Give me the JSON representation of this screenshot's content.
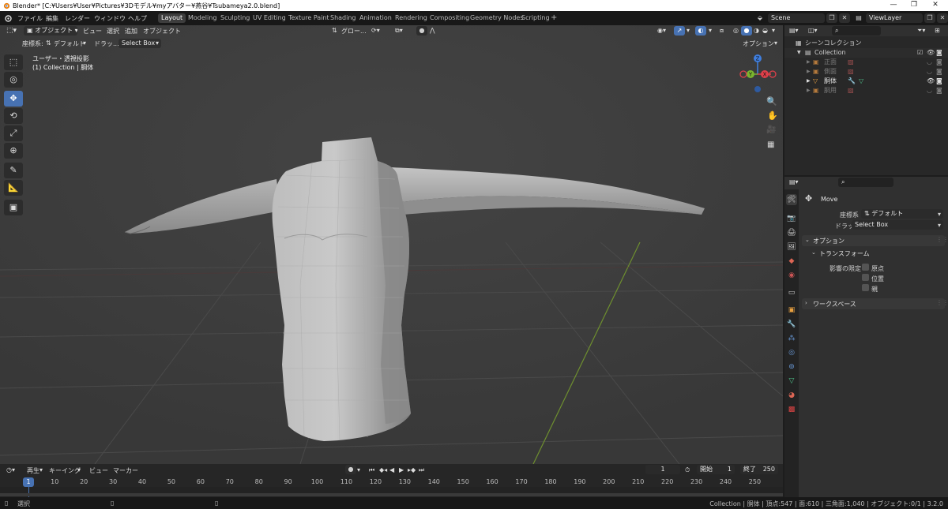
{
  "window": {
    "title": "Blender* [C:¥Users¥User¥Pictures¥3Dモデル¥myアバター¥燕谷¥Tsubameya2.0.blend]"
  },
  "menu": {
    "items": [
      "ファイル",
      "編集",
      "レンダー",
      "ウィンドウ",
      "ヘルプ"
    ],
    "workspaces": [
      "Layout",
      "Modeling",
      "Sculpting",
      "UV Editing",
      "Texture Paint",
      "Shading",
      "Animation",
      "Rendering",
      "Compositing",
      "Geometry Nodes",
      "Scripting"
    ],
    "active_workspace": "Layout",
    "add_tab": "+",
    "scene_label": "Scene",
    "viewlayer_label": "ViewLayer"
  },
  "viewport_header": {
    "mode": "オブジェクト",
    "menus": [
      "ビュー",
      "選択",
      "追加",
      "オブジェクト"
    ],
    "transform_orientation": "グロー...",
    "options_label": "オプション"
  },
  "tool_header": {
    "orientation_label": "座標系:",
    "orientation_value": "デフォルト",
    "drag_label": "ドラッ...",
    "drag_value": "Select Box"
  },
  "viewport": {
    "view_name": "ユーザー・透視投影",
    "collection_info": "(1) Collection | 胴体",
    "gizmo_axes": [
      "Z",
      "Y",
      "X"
    ]
  },
  "outliner": {
    "root": "シーンコレクション",
    "collection": "Collection",
    "objects": [
      {
        "name": "正面",
        "dimmed": true
      },
      {
        "name": "側面",
        "dimmed": true
      },
      {
        "name": "胴体",
        "dimmed": false
      },
      {
        "name": "胴用",
        "dimmed": true
      }
    ]
  },
  "properties": {
    "tool_name": "Move",
    "orientation_label": "座標系",
    "orientation_value": "デフォルト",
    "drag_label": "ドラッグ",
    "drag_value": "Select Box",
    "options_panel": "オプション",
    "transform_panel": "トランスフォーム",
    "affect_only_label": "影響の限定",
    "affect_only_items": [
      "原点",
      "位置",
      "親"
    ],
    "workspace_panel": "ワークスペース"
  },
  "timeline": {
    "menus": [
      "再生",
      "キーイング",
      "ビュー",
      "マーカー"
    ],
    "current_frame": "1",
    "start_label": "開始",
    "start_value": "1",
    "end_label": "終了",
    "end_value": "250",
    "ticks": [
      "1",
      "10",
      "20",
      "30",
      "40",
      "50",
      "60",
      "70",
      "80",
      "90",
      "100",
      "110",
      "120",
      "130",
      "140",
      "150",
      "160",
      "170",
      "180",
      "190",
      "200",
      "210",
      "220",
      "230",
      "240",
      "250"
    ]
  },
  "statusbar": {
    "select_label": "選択",
    "stats": "Collection | 胴体 | 頂点:547 | 面:610 | 三角面:1,040 | オブジェクト:0/1 | 3.2.0"
  },
  "colors": {
    "accent": "#4772b3",
    "axis_x": "#e0404a",
    "axis_y": "#7ab52e",
    "axis_z": "#3f7fe0"
  }
}
